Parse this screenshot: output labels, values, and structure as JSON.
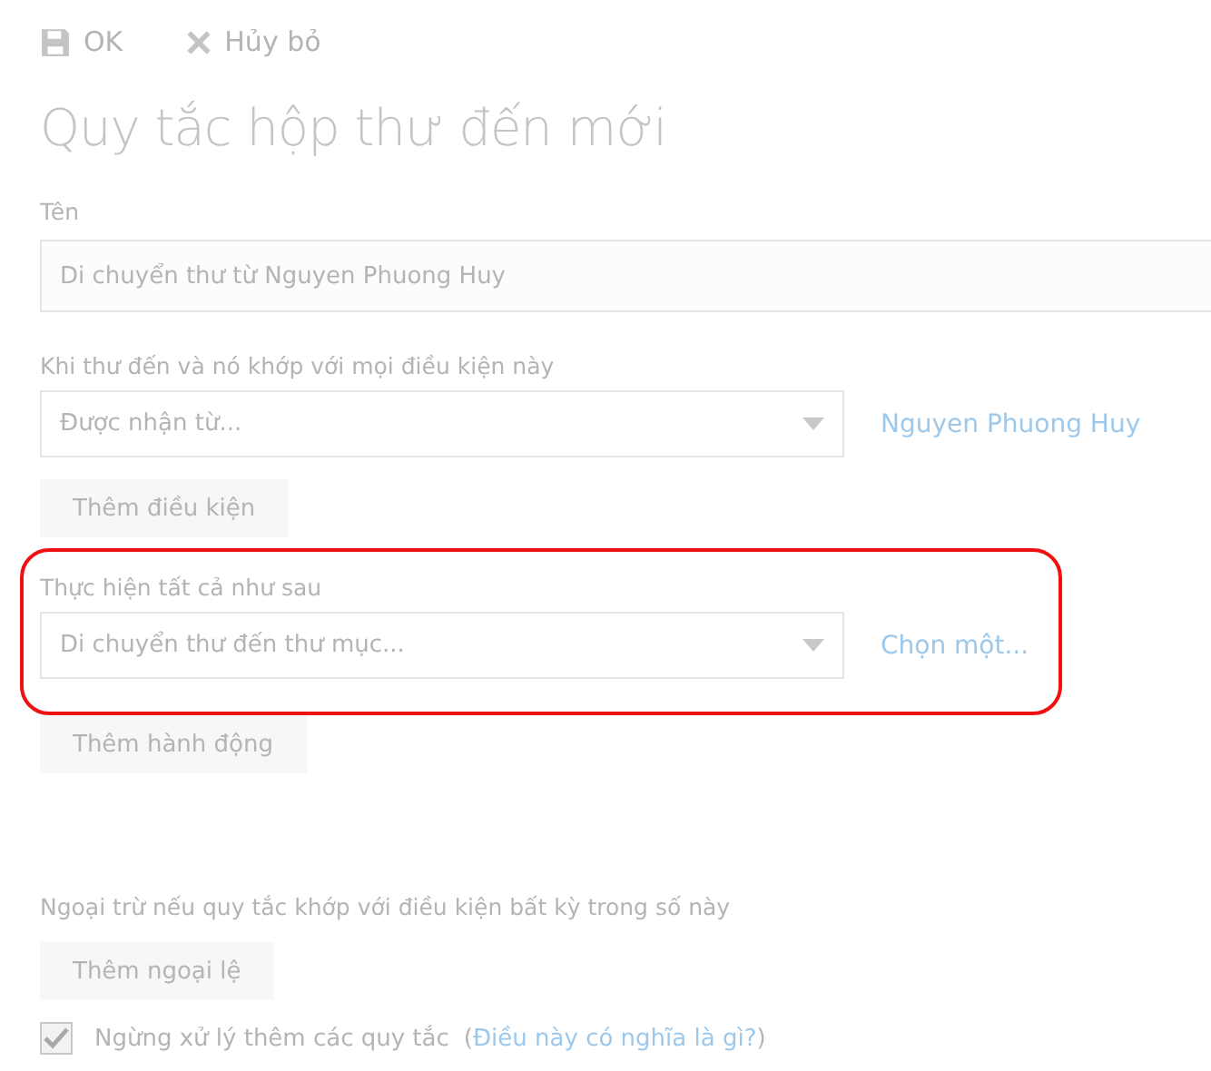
{
  "toolbar": [
    {
      "kind": "save",
      "label": "OK"
    },
    {
      "kind": "cancel",
      "label": "Hủy bỏ"
    }
  ],
  "title": "Quy tắc hộp thư đến mới",
  "name_field": {
    "label": "Tên",
    "value": "Di chuyển thư từ Nguyen Phuong Huy"
  },
  "conditions": {
    "label": "Khi thư đến và nó khớp với mọi điều kiện này",
    "dropdown": {
      "value": "Được nhận từ..."
    },
    "link": "Nguyen Phuong Huy",
    "button": "Thêm điều kiện",
    "highlighted": false
  },
  "actions": {
    "label": "Thực hiện tất cả như sau",
    "dropdown": {
      "value": "Di chuyển thư đến thư mục..."
    },
    "link": "Chọn một...",
    "button": "Thêm hành động",
    "highlighted": true
  },
  "exceptions": {
    "label": "Ngoại trừ nếu quy tắc khớp với điều kiện bất kỳ trong số này",
    "button": "Thêm ngoại lệ"
  },
  "stop_processing": {
    "checked": true,
    "label": "Ngừng xử lý thêm các quy tắc",
    "help_prefix": "(",
    "help_link": "Điều này có nghĩa là gì?",
    "help_suffix": ")"
  }
}
